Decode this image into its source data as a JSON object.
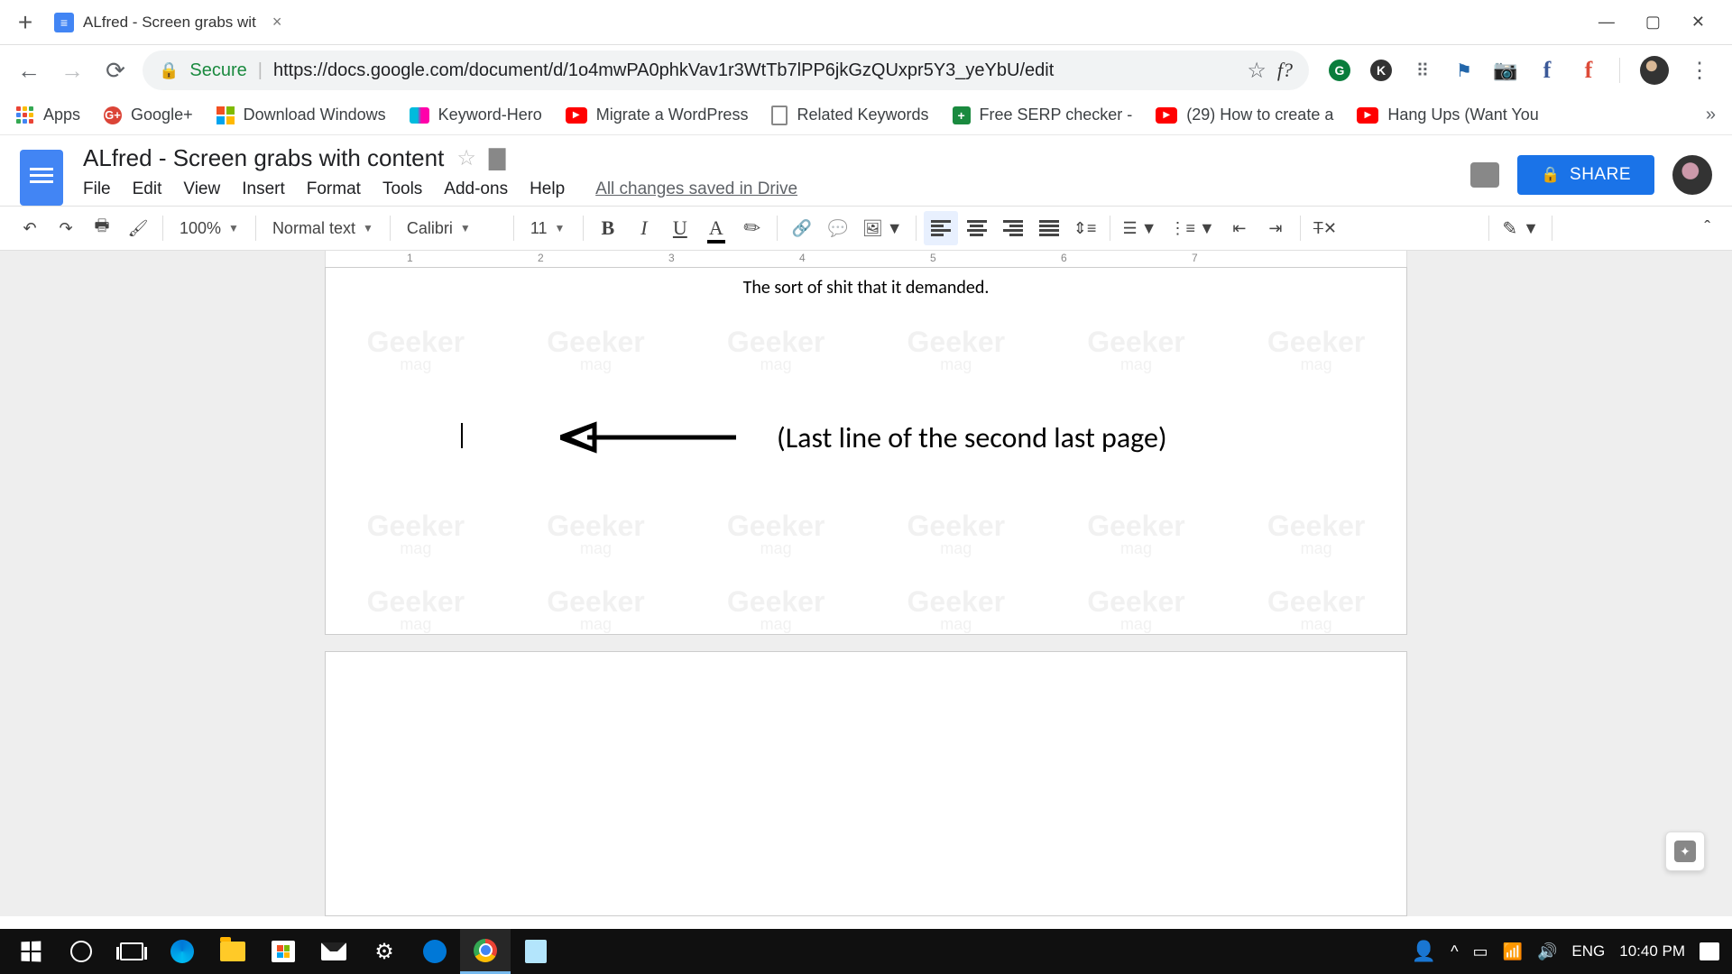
{
  "chrome": {
    "tab_title": "ALfred - Screen grabs wit",
    "url_secure": "Secure",
    "url_full": "https://docs.google.com/document/d/1o4mwPA0phkVav1r3WtTb7lPP6jkGzQUxpr5Y3_yeYbU/edit",
    "f_question": "f?"
  },
  "bookmarks": {
    "apps": "Apps",
    "gplus": "Google+",
    "downwin": "Download Windows",
    "kwhero": "Keyword-Hero",
    "migrate": "Migrate a WordPress",
    "related": "Related Keywords",
    "serp": "Free SERP checker -",
    "howto": "(29) How to create a",
    "hangups": "Hang Ups (Want You"
  },
  "docs": {
    "title": "ALfred - Screen grabs with content",
    "menu": {
      "file": "File",
      "edit": "Edit",
      "view": "View",
      "insert": "Insert",
      "format": "Format",
      "tools": "Tools",
      "addons": "Add-ons",
      "help": "Help"
    },
    "save_status": "All changes saved in Drive",
    "share": "SHARE"
  },
  "toolbar": {
    "zoom": "100%",
    "style": "Normal text",
    "font": "Calibri",
    "size": "11"
  },
  "ruler": {
    "n1": "1",
    "n2": "2",
    "n3": "3",
    "n4": "4",
    "n5": "5",
    "n6": "6",
    "n7": "7"
  },
  "document": {
    "line1": "The sort of shit that it demanded.",
    "annotation": "(Last line of the second last page)",
    "watermark_main": "Geeker",
    "watermark_sub": "mag"
  },
  "taskbar": {
    "lang": "ENG",
    "time": "10:40 PM"
  }
}
